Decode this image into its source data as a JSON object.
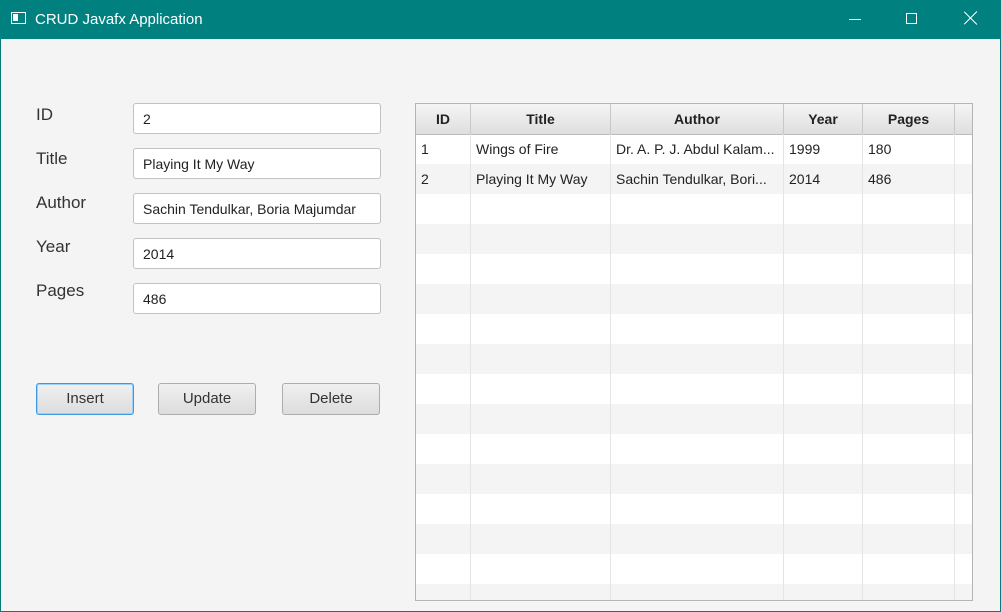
{
  "window": {
    "title": "CRUD Javafx Application",
    "controls": [
      "minimize-icon",
      "maximize-icon",
      "close-icon"
    ],
    "titlebar_color": "#00807f"
  },
  "form": {
    "id_label": "ID",
    "id_value": "2",
    "title_label": "Title",
    "title_value": "Playing It My Way",
    "author_label": "Author",
    "author_value": "Sachin Tendulkar, Boria Majumdar",
    "year_label": "Year",
    "year_value": "2014",
    "pages_label": "Pages",
    "pages_value": "486"
  },
  "buttons": {
    "insert": "Insert",
    "update": "Update",
    "delete": "Delete"
  },
  "table": {
    "columns": [
      "ID",
      "Title",
      "Author",
      "Year",
      "Pages"
    ],
    "rows": [
      [
        "1",
        "Wings of Fire",
        "Dr. A. P. J. Abdul Kalam...",
        "1999",
        "180"
      ],
      [
        "2",
        "Playing It My Way",
        "Sachin Tendulkar, Bori...",
        "2014",
        "486"
      ]
    ]
  }
}
